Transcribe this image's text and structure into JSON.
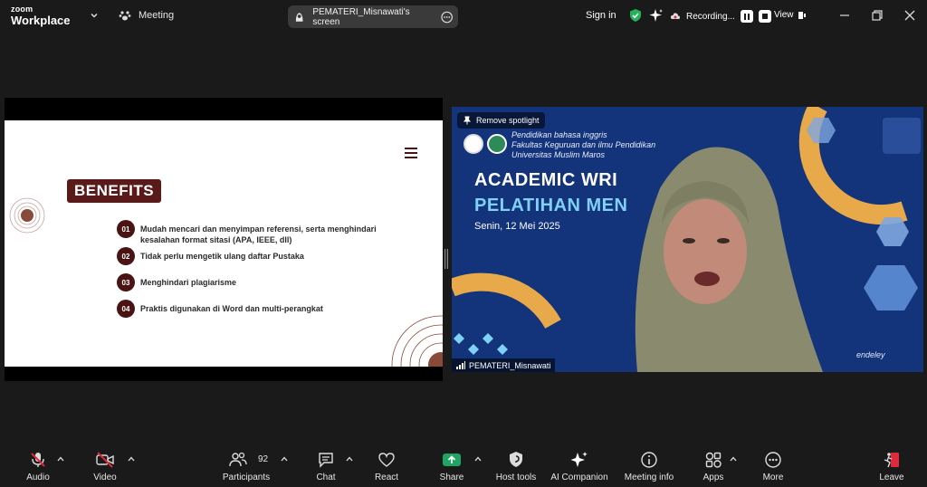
{
  "app": {
    "brand_top": "zoom",
    "brand_bottom": "Workplace"
  },
  "header": {
    "meeting_label": "Meeting",
    "screen_share_label": "PEMATERI_Misnawati's screen",
    "sign_in": "Sign in",
    "recording_label": "Recording...",
    "view_label": "View"
  },
  "slide": {
    "heading": "BENEFITS",
    "items": [
      {
        "num": "01",
        "text": "Mudah mencari dan menyimpan referensi, serta menghindari kesalahan format sitasi (APA, IEEE, dll)"
      },
      {
        "num": "02",
        "text": "Tidak perlu mengetik ulang daftar Pustaka"
      },
      {
        "num": "03",
        "text": "Menghindari plagiarisme"
      },
      {
        "num": "04",
        "text": "Praktis digunakan di Word dan multi-perangkat"
      }
    ]
  },
  "video": {
    "spotlight_label": "Remove spotlight",
    "institution_lines": [
      "Pendidikan bahasa inggris",
      "Fakultas Keguruan dan ilmu Pendidikan",
      "Universitas Muslim Maros"
    ],
    "title_line1": "ACADEMIC WRI",
    "title_line2": "PELATIHAN MEN",
    "date": "Senin, 12 Mei 2025",
    "corner_text": "endeley",
    "participant_name": "PEMATERI_Misnawati"
  },
  "toolbar": {
    "audio": "Audio",
    "video": "Video",
    "participants": "Participants",
    "participants_count": "92",
    "chat": "Chat",
    "react": "React",
    "share": "Share",
    "host_tools": "Host tools",
    "ai_companion": "AI Companion",
    "meeting_info": "Meeting info",
    "apps": "Apps",
    "more": "More",
    "leave": "Leave"
  },
  "colors": {
    "share_green": "#1fa463",
    "slide_accent": "#5a1a1a",
    "leave_red": "#e0293a",
    "video_bg": "#13337a"
  }
}
